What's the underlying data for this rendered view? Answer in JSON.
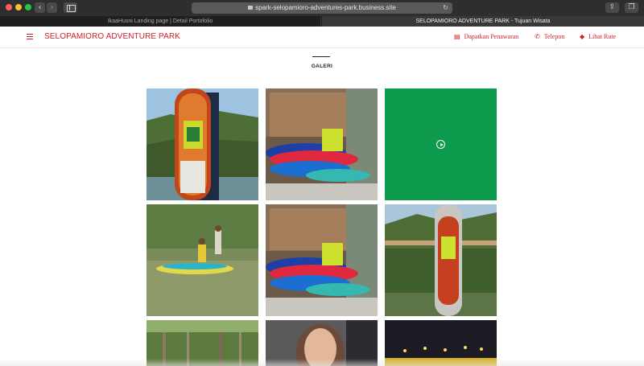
{
  "browser": {
    "url": "spark-selopamioro-adventures-park.business.site",
    "tabs": [
      {
        "label": "IkaaHusni Landing page | Detail Portofolio"
      },
      {
        "label": "SELOPAMIORO ADVENTURE PARK - Tujuan Wisata"
      }
    ]
  },
  "site": {
    "brand": "SELOPAMIORO ADVENTURE PARK",
    "actions": [
      {
        "label": "Dapatkan Penawaran",
        "icon": "offer-icon"
      },
      {
        "label": "Telepon",
        "icon": "phone-icon"
      },
      {
        "label": "Lihat Rute",
        "icon": "directions-icon"
      }
    ]
  },
  "gallery": {
    "title": "GALERI",
    "items": [
      {
        "kind": "photo",
        "subject": "paddleboard-on-riverbank",
        "icon": "image-icon"
      },
      {
        "kind": "photo",
        "subject": "stacked-kayaks-and-boards",
        "icon": "image-icon"
      },
      {
        "kind": "video",
        "subject": "video-thumbnail",
        "icon": "play-icon"
      },
      {
        "kind": "photo",
        "subject": "kayakers-on-river",
        "icon": "image-icon"
      },
      {
        "kind": "photo",
        "subject": "stacked-kayaks-and-boards",
        "icon": "image-icon"
      },
      {
        "kind": "photo",
        "subject": "paddleboard-near-bridge",
        "icon": "image-icon"
      },
      {
        "kind": "photo",
        "subject": "forest-trees",
        "icon": "image-icon"
      },
      {
        "kind": "photo",
        "subject": "person-portrait",
        "icon": "image-icon"
      },
      {
        "kind": "photo",
        "subject": "night-lights",
        "icon": "image-icon"
      }
    ]
  },
  "colors": {
    "accent": "#d0202a",
    "video_bg": "#0d9a4d",
    "chrome_bg": "#2e2e30"
  }
}
